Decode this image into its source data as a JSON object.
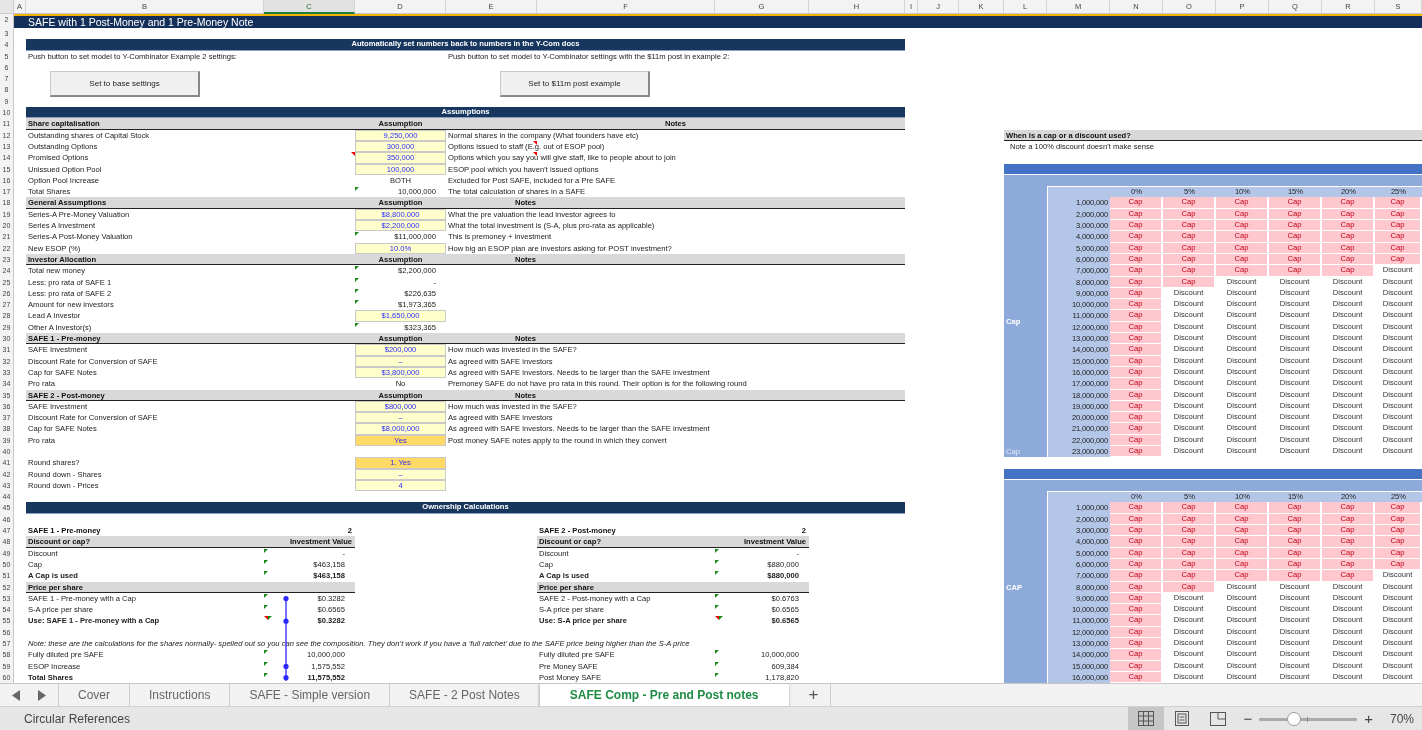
{
  "sheet": {
    "columns": [
      {
        "label": "A",
        "selected": false
      },
      {
        "label": "B",
        "selected": false
      },
      {
        "label": "C",
        "selected": true
      },
      {
        "label": "D",
        "selected": false
      },
      {
        "label": "E",
        "selected": false
      },
      {
        "label": "F",
        "selected": false
      },
      {
        "label": "G",
        "selected": false
      },
      {
        "label": "H",
        "selected": false
      },
      {
        "label": "I",
        "selected": false
      },
      {
        "label": "J",
        "selected": false
      },
      {
        "label": "K",
        "selected": false
      },
      {
        "label": "L",
        "selected": false
      },
      {
        "label": "M",
        "selected": false
      },
      {
        "label": "N",
        "selected": false
      },
      {
        "label": "O",
        "selected": false
      },
      {
        "label": "P",
        "selected": false
      },
      {
        "label": "Q",
        "selected": false
      },
      {
        "label": "R",
        "selected": false
      },
      {
        "label": "S",
        "selected": false
      }
    ],
    "rows": [
      "2",
      "3",
      "4",
      "5",
      "6",
      "7",
      "8",
      "9",
      "10",
      "11",
      "12",
      "13",
      "14",
      "15",
      "16",
      "17",
      "18",
      "19",
      "20",
      "21",
      "22",
      "23",
      "24",
      "25",
      "26",
      "27",
      "28",
      "29",
      "30",
      "31",
      "32",
      "33",
      "34",
      "35",
      "36",
      "37",
      "38",
      "39",
      "40",
      "41",
      "42",
      "43",
      "44",
      "45",
      "46",
      "47",
      "48",
      "49",
      "50",
      "51",
      "52",
      "53",
      "54",
      "55",
      "56",
      "57",
      "58",
      "59",
      "60"
    ]
  },
  "title": "SAFE with 1 Post-Money and 1 Pre-Money Note",
  "auto_settings": {
    "heading": "Automatically set numbers back to numbers in the Y-Com docs",
    "instructions": [
      "Push button to set model to Y-Combinator Example 2 settings:",
      "Push button to set model to Y-Combinator settings with the $11m post in example 2:"
    ],
    "buttons": [
      "Set to base settings",
      "Set to $11m post example"
    ]
  },
  "assumptions": {
    "heading": "Assumptions",
    "groups": [
      {
        "title": "Share capitalisation",
        "value_heading": "Assumption",
        "notes_heading": "Notes",
        "rows": [
          {
            "label": "Outstanding shares of Capital Stock",
            "value": "9,250,000",
            "kind": "input",
            "note": "Normal shares in the company (What founders have etc)",
            "comment": false,
            "note_comment": false
          },
          {
            "label": "Outstanding Options",
            "value": "300,000",
            "kind": "input",
            "note": "Options issued to staff (E.g. out of ESOP pool)",
            "comment": false,
            "note_comment": true
          },
          {
            "label": "Promised Options",
            "value": "350,000",
            "kind": "input",
            "note": "Options which you say you will give staff, like to people about to join",
            "comment": true,
            "note_comment": true
          },
          {
            "label": "Unissued Option Pool",
            "value": "100,000",
            "kind": "input",
            "note": "ESOP pool which you haven’t issued options",
            "comment": false,
            "note_comment": false
          },
          {
            "label": "Option Pool Increase",
            "value": "BOTH",
            "kind": "plain",
            "note": "Excluded for Post SAFE, included for a Pre SAFE",
            "comment": false,
            "note_comment": false
          },
          {
            "label": "Total Shares",
            "value": "10,000,000",
            "kind": "formula",
            "note": "The total calculation of shares in a SAFE",
            "comment": false,
            "note_comment": false
          }
        ]
      },
      {
        "title": "General Assumptions",
        "value_heading": "Assumption",
        "notes_heading": "Notes",
        "rows": [
          {
            "label": "Series-A Pre-Money Valuation",
            "value": "$8,800,000",
            "kind": "input",
            "note": "What the pre valuation the lead investor agrees to",
            "comment": false,
            "note_comment": false
          },
          {
            "label": "Series A Investment",
            "value": "$2,200,000",
            "kind": "input",
            "note": "What the total investment is (S-A, plus pro-rata as applicable)",
            "comment": false,
            "note_comment": false
          },
          {
            "label": "Series-A Post-Money Valuation",
            "value": "$11,000,000",
            "kind": "formula",
            "note": "This is premoney + investment",
            "comment": false,
            "note_comment": false
          },
          {
            "label": "New ESOP (%)",
            "value": "10.0%",
            "kind": "input",
            "note": "How big an ESOP plan are investors asking for POST investment?",
            "comment": false,
            "note_comment": false
          }
        ]
      },
      {
        "title": "Investor Allocation",
        "value_heading": "Assumption",
        "notes_heading": "Notes",
        "rows": [
          {
            "label": "Total new money",
            "value": "$2,200,000",
            "kind": "formula",
            "comment": false,
            "note_comment": false
          },
          {
            "label": "Less: pro rata of SAFE 1",
            "value": "-",
            "kind": "formula",
            "comment": false,
            "note_comment": false
          },
          {
            "label": "Less: pro rata of SAFE 2",
            "value": "$226,635",
            "kind": "formula",
            "comment": false,
            "note_comment": false
          },
          {
            "label": "Amount for new investors",
            "value": "$1,973,365",
            "kind": "formula",
            "comment": false,
            "note_comment": false
          },
          {
            "label": "Lead A Investor",
            "value": "$1,650,000",
            "kind": "input",
            "comment": false,
            "note_comment": false
          },
          {
            "label": "Other A Investor(s)",
            "value": "$323,365",
            "kind": "formula",
            "comment": false,
            "note_comment": false
          }
        ]
      },
      {
        "title": "SAFE 1 - Pre-money",
        "value_heading": "Assumption",
        "notes_heading": "Notes",
        "rows": [
          {
            "label": "SAFE Investment",
            "value": "$200,000",
            "kind": "input",
            "note": "How much was invested in the SAFE?",
            "comment": false,
            "note_comment": false
          },
          {
            "label": "Discount Rate for Conversion of SAFE",
            "value": "–",
            "kind": "input",
            "note": "As agreed with SAFE investors",
            "comment": false,
            "note_comment": false
          },
          {
            "label": "Cap for SAFE Notes",
            "value": "$3,800,000",
            "kind": "input",
            "note": "As agreed with SAFE investors. Needs to be larger than the SAFE investment",
            "comment": false,
            "note_comment": false
          },
          {
            "label": "Pro rata",
            "value": "No",
            "kind": "plain",
            "note": "Premoney SAFE do not have pro rata in this round. Their option is for the following round",
            "comment": false,
            "note_comment": false
          }
        ]
      },
      {
        "title": "SAFE 2 - Post-money",
        "value_heading": "Assumption",
        "notes_heading": "Notes",
        "rows": [
          {
            "label": "SAFE Investment",
            "value": "$800,000",
            "kind": "input",
            "note": "How much was invested in the SAFE?",
            "comment": false,
            "note_comment": false
          },
          {
            "label": "Discount Rate for Conversion of SAFE",
            "value": "–",
            "kind": "input",
            "note": "As agreed with SAFE investors",
            "comment": false,
            "note_comment": false
          },
          {
            "label": "Cap for SAFE Notes",
            "value": "$8,000,000",
            "kind": "input",
            "note": "As agreed with SAFE investors. Needs to be larger than the SAFE investment",
            "comment": false,
            "note_comment": false
          },
          {
            "label": "Pro rata",
            "value": "Yes",
            "kind": "highlight",
            "note": "Post money SAFE notes apply to the round in which they convert",
            "comment": false,
            "note_comment": false
          }
        ]
      }
    ]
  },
  "rounding": [
    {
      "label": "Round shares?",
      "value": "1. Yes",
      "kind": "highlight"
    },
    {
      "label": "Round down - Shares",
      "value": "–",
      "kind": "input"
    },
    {
      "label": "Round down - Prices",
      "value": "4",
      "kind": "input"
    }
  ],
  "ownership": {
    "heading": "Ownership Calculations",
    "tables": [
      {
        "title": "SAFE 1 - Pre-money",
        "count": "2",
        "subtitle": "Discount or cap?",
        "value_heading": "Investment Value",
        "rows": [
          {
            "kind": "line",
            "label": "Discount",
            "value": "-",
            "bold": false,
            "error_flag": true,
            "comment": false
          },
          {
            "kind": "line",
            "label": "Cap",
            "value": "$463,158",
            "bold": false,
            "error_flag": true,
            "comment": false
          },
          {
            "kind": "line",
            "label": "A Cap is used",
            "value": "$463,158",
            "bold": true,
            "error_flag": true,
            "comment": false
          },
          {
            "kind": "heading",
            "label": "Price per share"
          },
          {
            "kind": "line",
            "label": "SAFE 1 - Pre-money with a Cap",
            "value": "$0.3282",
            "bold": false,
            "error_flag": true,
            "comment": false
          },
          {
            "kind": "line",
            "label": "S-A price per share",
            "value": "$0.6565",
            "bold": false,
            "error_flag": true,
            "comment": false
          },
          {
            "kind": "line",
            "label": "Use: SAFE 1 - Pre-money with a Cap",
            "value": "$0.3282",
            "bold": true,
            "error_flag": true,
            "comment": true
          }
        ]
      },
      {
        "title": "SAFE 2 - Post-money",
        "count": "2",
        "subtitle": "Discount or cap?",
        "value_heading": "Investment Value",
        "rows": [
          {
            "kind": "line",
            "label": "Discount",
            "value": "-",
            "bold": false,
            "error_flag": true,
            "comment": false
          },
          {
            "kind": "line",
            "label": "Cap",
            "value": "$880,000",
            "bold": false,
            "error_flag": true,
            "comment": false
          },
          {
            "kind": "line",
            "label": "A Cap is used",
            "value": "$880,000",
            "bold": true,
            "error_flag": true,
            "comment": false
          },
          {
            "kind": "heading",
            "label": "Price per share"
          },
          {
            "kind": "line",
            "label": "SAFE 2 - Post-money with a Cap",
            "value": "$0.6763",
            "bold": false,
            "error_flag": true,
            "comment": false
          },
          {
            "kind": "line",
            "label": "S-A price per share",
            "value": "$0.6565",
            "bold": false,
            "error_flag": true,
            "comment": false
          },
          {
            "kind": "line",
            "label": "Use: S-A price per share",
            "value": "$0.6565",
            "bold": true,
            "error_flag": true,
            "comment": true
          }
        ]
      }
    ],
    "note": "Note: these are the calculations for the shares normally- spelled out so you can see the composition. They don’t work if you have a ‘full ratchet’ due to the SAFE price being higher than the S-A price",
    "share_columns": [
      {
        "rows": [
          {
            "label": "Fully diluted pre SAFE",
            "value": "10,000,000",
            "bold": false
          },
          {
            "label": "ESOP Increase",
            "value": "1,575,552",
            "bold": false
          },
          {
            "label": "Total Shares",
            "value": "11,575,552",
            "bold": true
          }
        ]
      },
      {
        "rows": [
          {
            "label": "Fully diluted pre SAFE",
            "value": "10,000,000",
            "bold": false
          },
          {
            "label": "Pre Money SAFE",
            "value": "609,384",
            "bold": false
          },
          {
            "label": "Post Money SAFE",
            "value": "1,178,820",
            "bold": false
          }
        ]
      }
    ]
  },
  "cap_or_discount": {
    "heading": "When is a cap or a discount used?",
    "note": "Note a 100% discount doesn’t make sense",
    "grids": [
      {
        "side_label": "Cap",
        "footer_label": "Cap",
        "columns": [
          "0%",
          "5%",
          "10%",
          "15%",
          "20%",
          "25%"
        ],
        "rows": [
          {
            "label": "1,000,000",
            "values": [
              "Cap",
              "Cap",
              "Cap",
              "Cap",
              "Cap",
              "Cap"
            ],
            "highlighted": [
              true,
              true,
              true,
              true,
              true,
              true
            ]
          },
          {
            "label": "2,000,000",
            "values": [
              "Cap",
              "Cap",
              "Cap",
              "Cap",
              "Cap",
              "Cap"
            ],
            "highlighted": [
              true,
              true,
              true,
              true,
              true,
              true
            ]
          },
          {
            "label": "3,000,000",
            "values": [
              "Cap",
              "Cap",
              "Cap",
              "Cap",
              "Cap",
              "Cap"
            ],
            "highlighted": [
              true,
              true,
              true,
              true,
              true,
              true
            ]
          },
          {
            "label": "4,000,000",
            "values": [
              "Cap",
              "Cap",
              "Cap",
              "Cap",
              "Cap",
              "Cap"
            ],
            "highlighted": [
              true,
              true,
              true,
              true,
              true,
              true
            ]
          },
          {
            "label": "5,000,000",
            "values": [
              "Cap",
              "Cap",
              "Cap",
              "Cap",
              "Cap",
              "Cap"
            ],
            "highlighted": [
              true,
              true,
              true,
              true,
              true,
              true
            ]
          },
          {
            "label": "6,000,000",
            "values": [
              "Cap",
              "Cap",
              "Cap",
              "Cap",
              "Cap",
              "Cap"
            ],
            "highlighted": [
              true,
              true,
              true,
              true,
              true,
              true
            ]
          },
          {
            "label": "7,000,000",
            "values": [
              "Cap",
              "Cap",
              "Cap",
              "Cap",
              "Cap",
              "Discount"
            ],
            "highlighted": [
              true,
              true,
              true,
              true,
              true,
              false
            ]
          },
          {
            "label": "8,000,000",
            "values": [
              "Cap",
              "Cap",
              "Discount",
              "Discount",
              "Discount",
              "Discount"
            ],
            "highlighted": [
              true,
              true,
              false,
              false,
              false,
              false
            ]
          },
          {
            "label": "9,000,000",
            "values": [
              "Cap",
              "Discount",
              "Discount",
              "Discount",
              "Discount",
              "Discount"
            ],
            "highlighted": [
              true,
              false,
              false,
              false,
              false,
              false
            ]
          },
          {
            "label": "10,000,000",
            "values": [
              "Cap",
              "Discount",
              "Discount",
              "Discount",
              "Discount",
              "Discount"
            ],
            "highlighted": [
              true,
              false,
              false,
              false,
              false,
              false
            ]
          },
          {
            "label": "11,000,000",
            "values": [
              "Cap",
              "Discount",
              "Discount",
              "Discount",
              "Discount",
              "Discount"
            ],
            "highlighted": [
              true,
              false,
              false,
              false,
              false,
              false
            ]
          },
          {
            "label": "12,000,000",
            "values": [
              "Cap",
              "Discount",
              "Discount",
              "Discount",
              "Discount",
              "Discount"
            ],
            "highlighted": [
              true,
              false,
              false,
              false,
              false,
              false
            ]
          },
          {
            "label": "13,000,000",
            "values": [
              "Cap",
              "Discount",
              "Discount",
              "Discount",
              "Discount",
              "Discount"
            ],
            "highlighted": [
              true,
              false,
              false,
              false,
              false,
              false
            ]
          },
          {
            "label": "14,000,000",
            "values": [
              "Cap",
              "Discount",
              "Discount",
              "Discount",
              "Discount",
              "Discount"
            ],
            "highlighted": [
              true,
              false,
              false,
              false,
              false,
              false
            ]
          },
          {
            "label": "15,000,000",
            "values": [
              "Cap",
              "Discount",
              "Discount",
              "Discount",
              "Discount",
              "Discount"
            ],
            "highlighted": [
              true,
              false,
              false,
              false,
              false,
              false
            ]
          },
          {
            "label": "16,000,000",
            "values": [
              "Cap",
              "Discount",
              "Discount",
              "Discount",
              "Discount",
              "Discount"
            ],
            "highlighted": [
              true,
              false,
              false,
              false,
              false,
              false
            ]
          },
          {
            "label": "17,000,000",
            "values": [
              "Cap",
              "Discount",
              "Discount",
              "Discount",
              "Discount",
              "Discount"
            ],
            "highlighted": [
              true,
              false,
              false,
              false,
              false,
              false
            ]
          },
          {
            "label": "18,000,000",
            "values": [
              "Cap",
              "Discount",
              "Discount",
              "Discount",
              "Discount",
              "Discount"
            ],
            "highlighted": [
              true,
              false,
              false,
              false,
              false,
              false
            ]
          },
          {
            "label": "19,000,000",
            "values": [
              "Cap",
              "Discount",
              "Discount",
              "Discount",
              "Discount",
              "Discount"
            ],
            "highlighted": [
              true,
              false,
              false,
              false,
              false,
              false
            ]
          },
          {
            "label": "20,000,000",
            "values": [
              "Cap",
              "Discount",
              "Discount",
              "Discount",
              "Discount",
              "Discount"
            ],
            "highlighted": [
              true,
              false,
              false,
              false,
              false,
              false
            ]
          },
          {
            "label": "21,000,000",
            "values": [
              "Cap",
              "Discount",
              "Discount",
              "Discount",
              "Discount",
              "Discount"
            ],
            "highlighted": [
              true,
              false,
              false,
              false,
              false,
              false
            ]
          },
          {
            "label": "22,000,000",
            "values": [
              "Cap",
              "Discount",
              "Discount",
              "Discount",
              "Discount",
              "Discount"
            ],
            "highlighted": [
              true,
              false,
              false,
              false,
              false,
              false
            ]
          },
          {
            "label": "23,000,000",
            "values": [
              "Cap",
              "Discount",
              "Discount",
              "Discount",
              "Discount",
              "Discount"
            ],
            "highlighted": [
              true,
              false,
              false,
              false,
              false,
              false
            ]
          }
        ]
      },
      {
        "side_label": "CAP",
        "columns": [
          "0%",
          "5%",
          "10%",
          "15%",
          "20%",
          "25%"
        ],
        "rows": [
          {
            "label": "1,000,000",
            "values": [
              "Cap",
              "Cap",
              "Cap",
              "Cap",
              "Cap",
              "Cap"
            ],
            "highlighted": [
              true,
              true,
              true,
              true,
              true,
              true
            ]
          },
          {
            "label": "2,000,000",
            "values": [
              "Cap",
              "Cap",
              "Cap",
              "Cap",
              "Cap",
              "Cap"
            ],
            "highlighted": [
              true,
              true,
              true,
              true,
              true,
              true
            ]
          },
          {
            "label": "3,000,000",
            "values": [
              "Cap",
              "Cap",
              "Cap",
              "Cap",
              "Cap",
              "Cap"
            ],
            "highlighted": [
              true,
              true,
              true,
              true,
              true,
              true
            ]
          },
          {
            "label": "4,000,000",
            "values": [
              "Cap",
              "Cap",
              "Cap",
              "Cap",
              "Cap",
              "Cap"
            ],
            "highlighted": [
              true,
              true,
              true,
              true,
              true,
              true
            ]
          },
          {
            "label": "5,000,000",
            "values": [
              "Cap",
              "Cap",
              "Cap",
              "Cap",
              "Cap",
              "Cap"
            ],
            "highlighted": [
              true,
              true,
              true,
              true,
              true,
              true
            ]
          },
          {
            "label": "6,000,000",
            "values": [
              "Cap",
              "Cap",
              "Cap",
              "Cap",
              "Cap",
              "Cap"
            ],
            "highlighted": [
              true,
              true,
              true,
              true,
              true,
              true
            ]
          },
          {
            "label": "7,000,000",
            "values": [
              "Cap",
              "Cap",
              "Cap",
              "Cap",
              "Cap",
              "Discount"
            ],
            "highlighted": [
              true,
              true,
              true,
              true,
              true,
              false
            ]
          },
          {
            "label": "8,000,000",
            "values": [
              "Cap",
              "Cap",
              "Discount",
              "Discount",
              "Discount",
              "Discount"
            ],
            "highlighted": [
              true,
              true,
              false,
              false,
              false,
              false
            ]
          },
          {
            "label": "9,000,000",
            "values": [
              "Cap",
              "Discount",
              "Discount",
              "Discount",
              "Discount",
              "Discount"
            ],
            "highlighted": [
              true,
              false,
              false,
              false,
              false,
              false
            ]
          },
          {
            "label": "10,000,000",
            "values": [
              "Cap",
              "Discount",
              "Discount",
              "Discount",
              "Discount",
              "Discount"
            ],
            "highlighted": [
              true,
              false,
              false,
              false,
              false,
              false
            ]
          },
          {
            "label": "11,000,000",
            "values": [
              "Cap",
              "Discount",
              "Discount",
              "Discount",
              "Discount",
              "Discount"
            ],
            "highlighted": [
              true,
              false,
              false,
              false,
              false,
              false
            ]
          },
          {
            "label": "12,000,000",
            "values": [
              "Cap",
              "Discount",
              "Discount",
              "Discount",
              "Discount",
              "Discount"
            ],
            "highlighted": [
              true,
              false,
              false,
              false,
              false,
              false
            ]
          },
          {
            "label": "13,000,000",
            "values": [
              "Cap",
              "Discount",
              "Discount",
              "Discount",
              "Discount",
              "Discount"
            ],
            "highlighted": [
              true,
              false,
              false,
              false,
              false,
              false
            ]
          },
          {
            "label": "14,000,000",
            "values": [
              "Cap",
              "Discount",
              "Discount",
              "Discount",
              "Discount",
              "Discount"
            ],
            "highlighted": [
              true,
              false,
              false,
              false,
              false,
              false
            ]
          },
          {
            "label": "15,000,000",
            "values": [
              "Cap",
              "Discount",
              "Discount",
              "Discount",
              "Discount",
              "Discount"
            ],
            "highlighted": [
              true,
              false,
              false,
              false,
              false,
              false
            ]
          },
          {
            "label": "16,000,000",
            "values": [
              "Cap",
              "Discount",
              "Discount",
              "Discount",
              "Discount",
              "Discount"
            ],
            "highlighted": [
              true,
              false,
              false,
              false,
              false,
              false
            ]
          }
        ]
      }
    ]
  },
  "sheet_tabs": [
    {
      "label": "Cover",
      "selected": false
    },
    {
      "label": "Instructions",
      "selected": false
    },
    {
      "label": "SAFE - Simple version",
      "selected": false
    },
    {
      "label": "SAFE - 2 Post Notes",
      "selected": false
    },
    {
      "label": "SAFE Comp - Pre and Post notes",
      "selected": true
    }
  ],
  "add_sheet": "+",
  "status_bar": {
    "text": "Circular References",
    "views": [
      {
        "kind": "normal",
        "selected": true
      },
      {
        "kind": "page_layout",
        "selected": false
      },
      {
        "kind": "page_break",
        "selected": false
      }
    ],
    "zoom_out": "−",
    "zoom_in": "+",
    "zoom": {
      "level": 0.35,
      "label": "70%"
    }
  }
}
